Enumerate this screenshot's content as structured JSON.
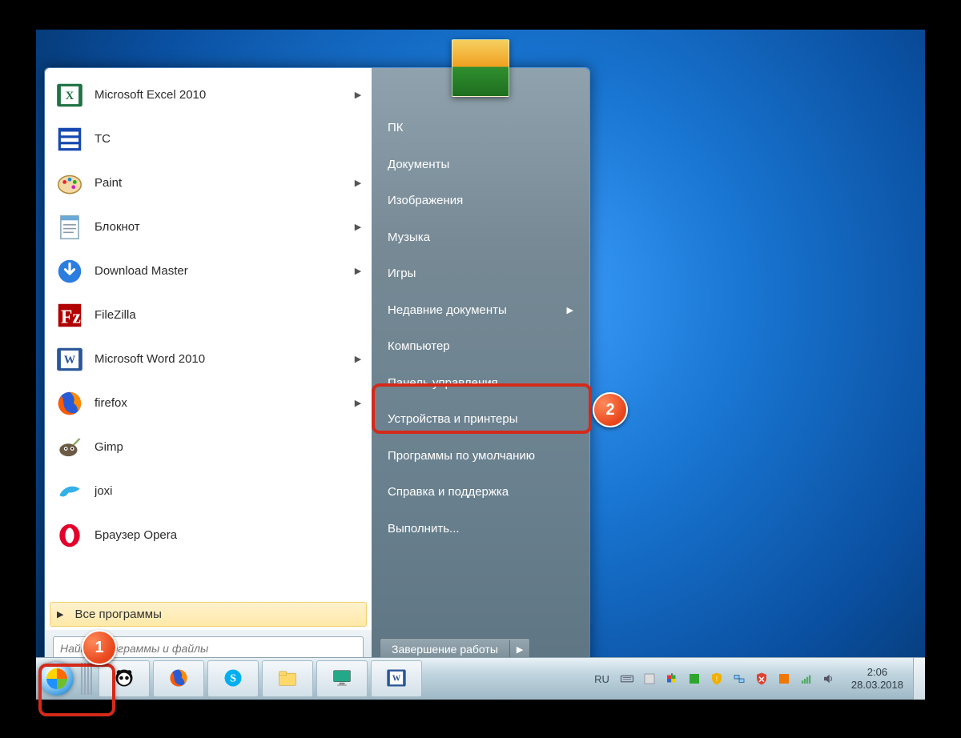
{
  "start_menu": {
    "programs": [
      {
        "label": "Microsoft Excel 2010",
        "icon": "excel",
        "submenu": true
      },
      {
        "label": "TC",
        "icon": "tc",
        "submenu": false
      },
      {
        "label": "Paint",
        "icon": "paint",
        "submenu": true
      },
      {
        "label": "Блокнот",
        "icon": "notepad",
        "submenu": true
      },
      {
        "label": "Download Master",
        "icon": "dm",
        "submenu": true
      },
      {
        "label": "FileZilla",
        "icon": "filezilla",
        "submenu": false
      },
      {
        "label": "Microsoft Word 2010",
        "icon": "word",
        "submenu": true
      },
      {
        "label": "firefox",
        "icon": "firefox",
        "submenu": true
      },
      {
        "label": "Gimp",
        "icon": "gimp",
        "submenu": false
      },
      {
        "label": "joxi",
        "icon": "joxi",
        "submenu": false
      },
      {
        "label": "Браузер Opera",
        "icon": "opera",
        "submenu": false
      }
    ],
    "all_programs": "Все программы",
    "search_placeholder": "Найти программы и файлы",
    "right_links": [
      {
        "label": "ПК",
        "submenu": false
      },
      {
        "label": "Документы",
        "submenu": false
      },
      {
        "label": "Изображения",
        "submenu": false
      },
      {
        "label": "Музыка",
        "submenu": false
      },
      {
        "label": "Игры",
        "submenu": false
      },
      {
        "label": "Недавние документы",
        "submenu": true
      },
      {
        "label": "Компьютер",
        "submenu": false
      },
      {
        "label": "Панель управления",
        "submenu": false
      },
      {
        "label": "Устройства и принтеры",
        "submenu": false
      },
      {
        "label": "Программы по умолчанию",
        "submenu": false
      },
      {
        "label": "Справка и поддержка",
        "submenu": false
      },
      {
        "label": "Выполнить...",
        "submenu": false
      }
    ],
    "shutdown_label": "Завершение работы"
  },
  "taskbar": {
    "items": [
      "panda",
      "firefox",
      "skype",
      "explorer",
      "display",
      "word"
    ],
    "lang": "RU",
    "tray": [
      "keyboard",
      "box",
      "flag",
      "green",
      "shield-warn",
      "net",
      "shield-x",
      "orange",
      "wifi",
      "volume"
    ],
    "clock_time": "2:06",
    "clock_date": "28.03.2018"
  },
  "callouts": {
    "one": "1",
    "two": "2"
  }
}
